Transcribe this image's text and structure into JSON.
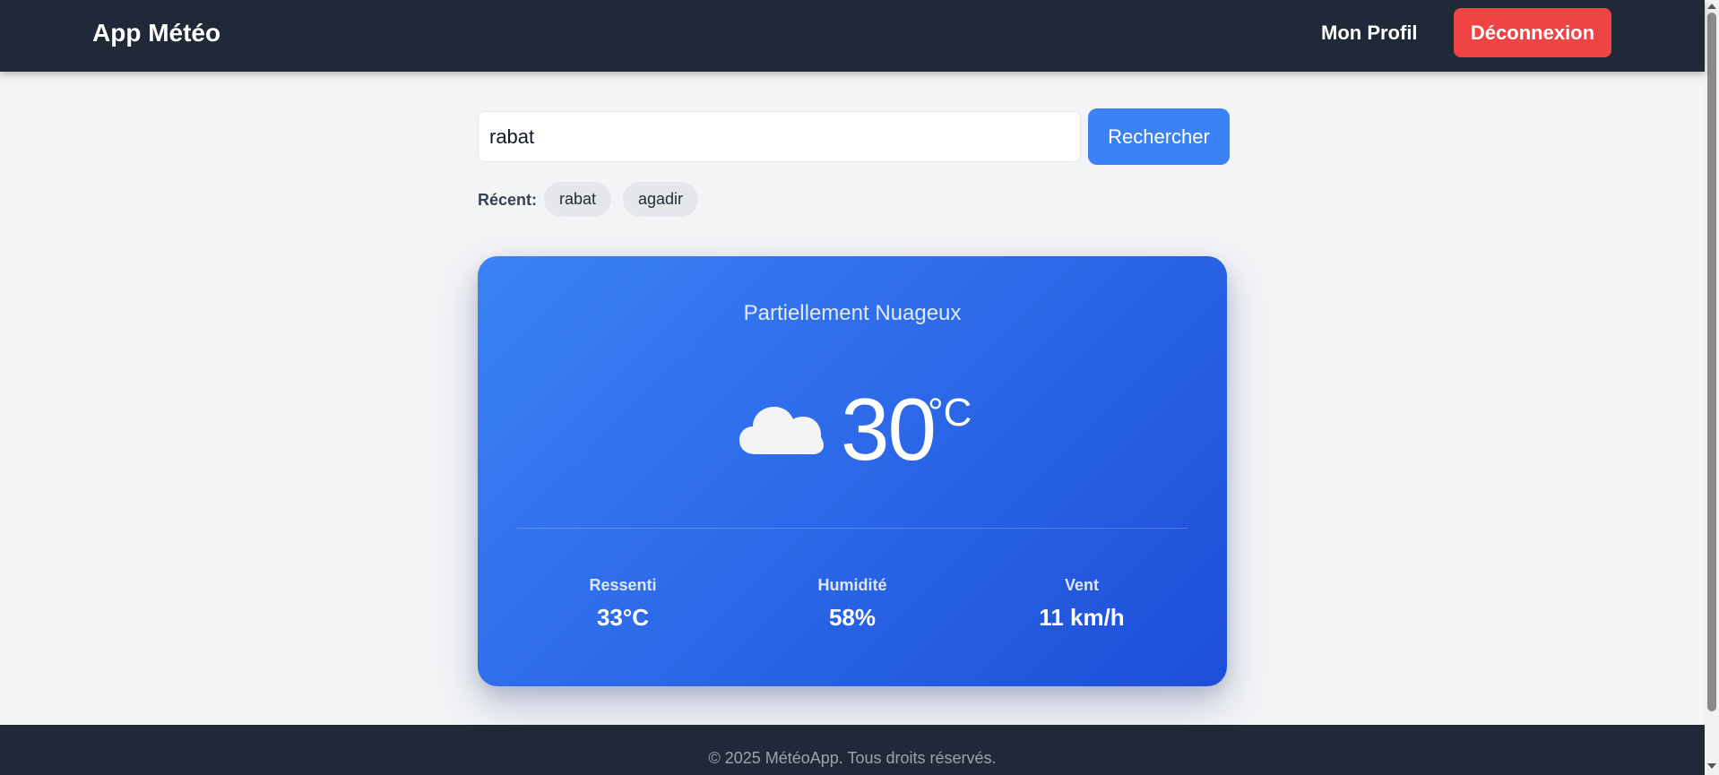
{
  "header": {
    "brand": "App Météo",
    "profile_label": "Mon Profil",
    "logout_label": "Déconnexion"
  },
  "search": {
    "value": "rabat",
    "button_label": "Rechercher"
  },
  "recent": {
    "label": "Récent:",
    "items": [
      "rabat",
      "agadir"
    ]
  },
  "weather": {
    "condition": "Partiellement Nuageux",
    "icon": "cloud-icon",
    "temperature": "30",
    "unit": "°C",
    "stats": [
      {
        "label": "Ressenti",
        "value": "33°C"
      },
      {
        "label": "Humidité",
        "value": "58%"
      },
      {
        "label": "Vent",
        "value": "11 km/h"
      }
    ]
  },
  "footer": {
    "text": "© 2025 MétéoApp. Tous droits réservés."
  },
  "colors": {
    "header_bg": "#1f2937",
    "logout": "#ef4444",
    "accent": "#3b82f6",
    "card_gradient_end": "#1d4ed8",
    "page_bg": "#f3f4f6"
  }
}
